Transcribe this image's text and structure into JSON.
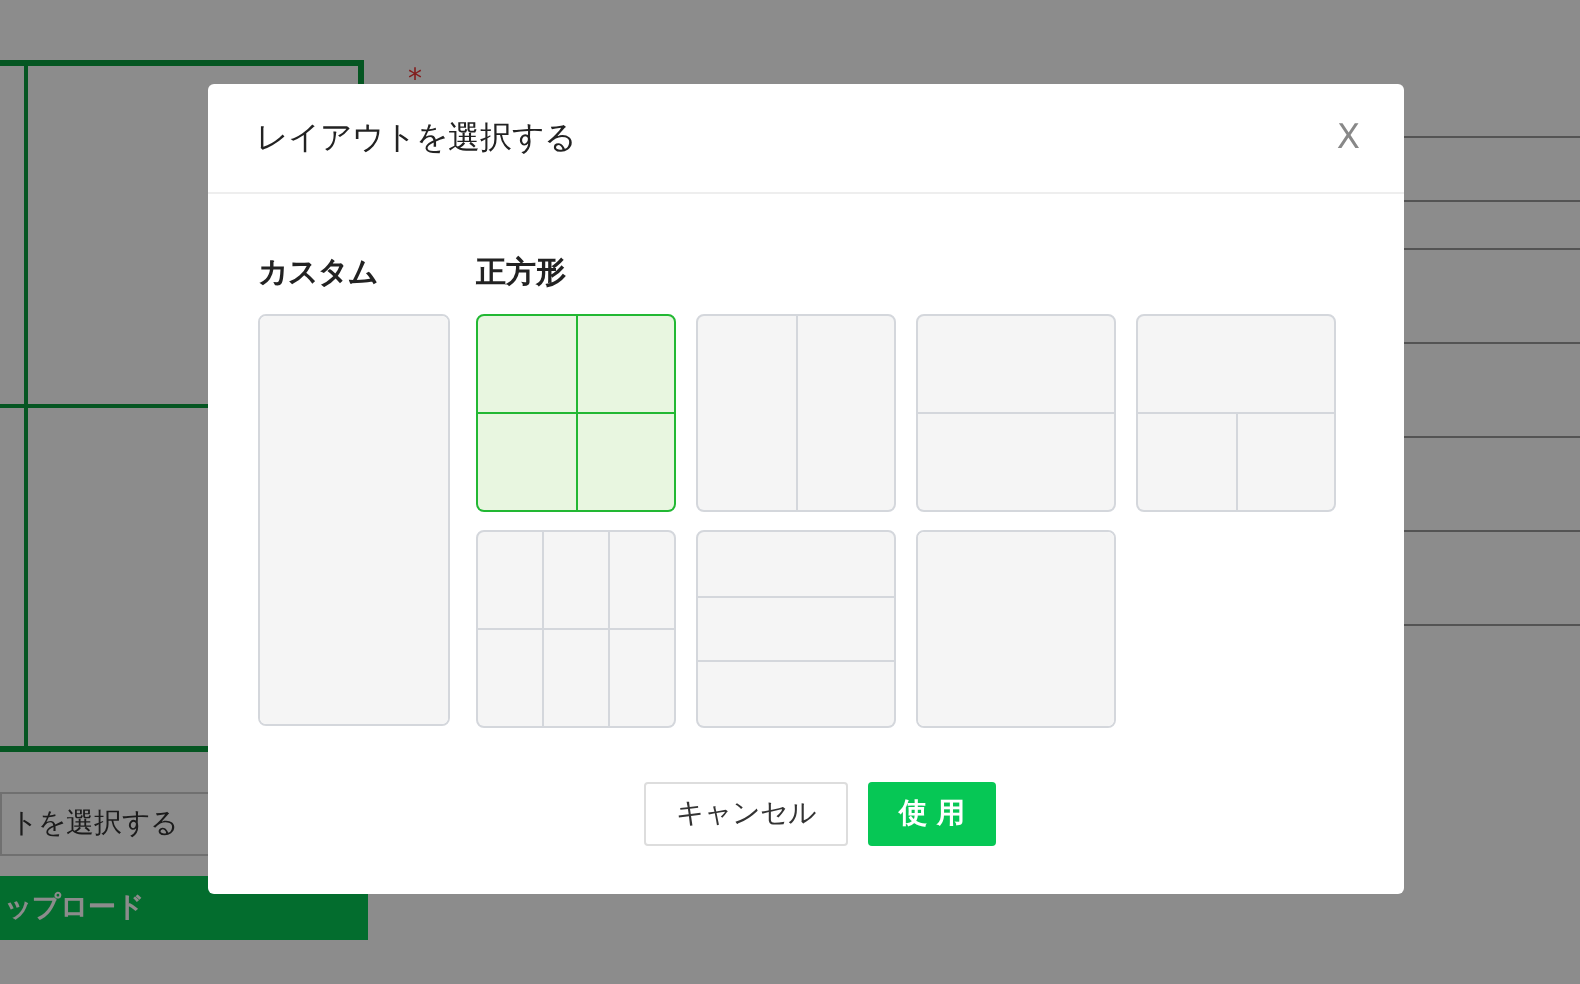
{
  "background": {
    "title_label": {
      "required_mark": "*"
    },
    "select_button": "トを選択する",
    "upload_button": "ップロード"
  },
  "dialog": {
    "title": "レイアウトを選択する",
    "close": "X",
    "sections": [
      {
        "label": "カスタム",
        "layouts": [
          {
            "kind": "tall",
            "selected": false
          }
        ]
      },
      {
        "label": "正方形",
        "layouts": [
          {
            "kind": "grid-2x2",
            "selected": true
          },
          {
            "kind": "cols-2",
            "selected": false
          },
          {
            "kind": "rows-2",
            "selected": false
          },
          {
            "kind": "top-1-bottom-2",
            "selected": false
          },
          {
            "kind": "grid-3x2",
            "selected": false
          },
          {
            "kind": "rows-3",
            "selected": false
          },
          {
            "kind": "single",
            "selected": false
          }
        ]
      }
    ],
    "buttons": {
      "cancel": "キャンセル",
      "use": "使 用"
    }
  }
}
